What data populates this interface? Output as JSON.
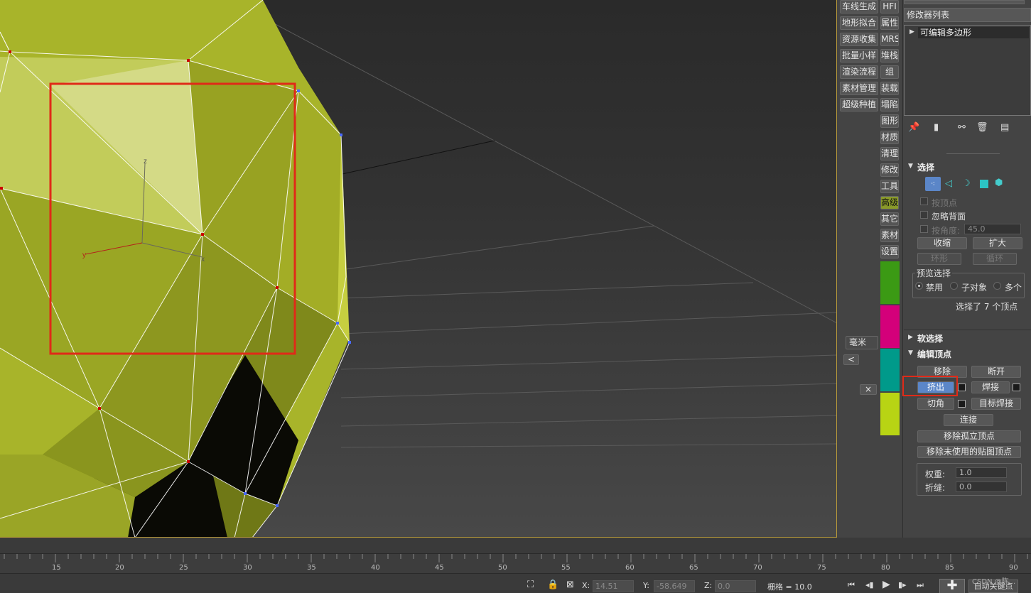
{
  "tool_column": {
    "left_buttons": [
      "车线生成",
      "地形拟合",
      "资源收集",
      "批量小样",
      "渲染流程",
      "素材管理",
      "超级种植"
    ],
    "right_buttons": [
      "HFI",
      "属性",
      "MRS",
      "堆栈",
      "组",
      "装载",
      "塌陷",
      "图形",
      "材质",
      "清理",
      "修改",
      "工具",
      "高级",
      "其它",
      "素材",
      "设置"
    ],
    "highlighted": "高级",
    "swatches": [
      "#3b9a14",
      "#d4007a",
      "#009a8a",
      "#b8d414"
    ],
    "unit": "毫米",
    "back_glyph": "<",
    "close_glyph": "×"
  },
  "modifier": {
    "list_label": "修改器列表",
    "stack_item": "可编辑多边形"
  },
  "selection": {
    "title": "选择",
    "by_vertex": "按顶点",
    "ignore_backface": "忽略背面",
    "by_angle": "按角度:",
    "angle_value": "45.0",
    "shrink": "收缩",
    "grow": "扩大",
    "ring": "环形",
    "loop": "循环",
    "preview_title": "预览选择",
    "preview_options": [
      "禁用",
      "子对象",
      "多个"
    ],
    "status": "选择了 7 个顶点"
  },
  "soft_selection": {
    "title": "软选择"
  },
  "edit_vertices": {
    "title": "编辑顶点",
    "remove": "移除",
    "break": "断开",
    "extrude": "挤出",
    "weld": "焊接",
    "chamfer": "切角",
    "target_weld": "目标焊接",
    "connect": "连接",
    "remove_isolated": "移除孤立顶点",
    "remove_unused_map": "移除未使用的贴图顶点",
    "weight_label": "权重:",
    "weight_value": "1.0",
    "crease_label": "折缝:",
    "crease_value": "0.0"
  },
  "timeline": {
    "ticks": [
      "15",
      "20",
      "25",
      "30",
      "35",
      "40",
      "45",
      "50",
      "55",
      "60",
      "65",
      "70",
      "75",
      "80",
      "85",
      "90"
    ]
  },
  "status": {
    "x_label": "X:",
    "x_value": "14.51",
    "y_label": "Y:",
    "y_value": "-58.649",
    "z_label": "Z:",
    "z_value": "0.0",
    "grid": "栅格 = 10.0",
    "auto_key": "自动关键点",
    "watermark": "CSDN @陈..."
  },
  "viewport": {
    "gizmo_axes": {
      "x": "x",
      "y": "y",
      "z": "z"
    },
    "mesh_color": "#a8b42a",
    "selection_rect_color": "#e02a18",
    "highlight_color": "#e02a18"
  }
}
